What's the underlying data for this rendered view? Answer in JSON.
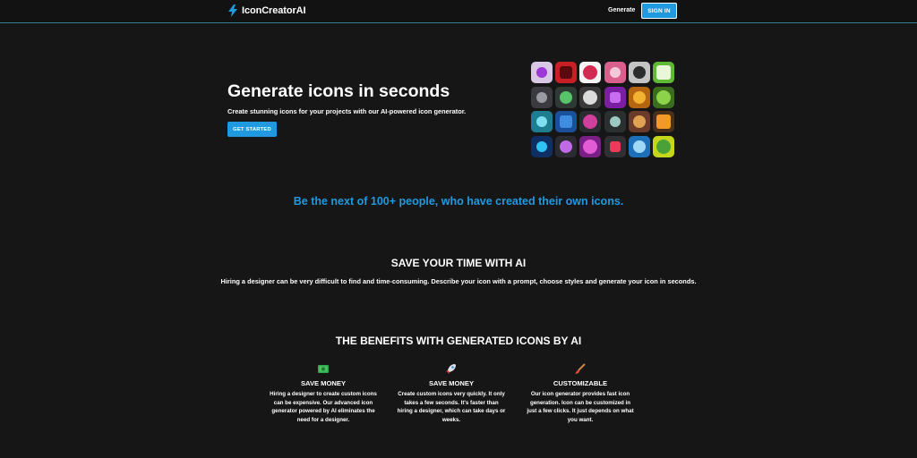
{
  "navbar": {
    "brand": "IconCreatorAI",
    "generate_link": "Generate",
    "signin_button": "SIGN IN"
  },
  "hero": {
    "title": "Generate icons in seconds",
    "subtitle": "Create stunning icons for your projects with our AI-powered icon generator.",
    "cta": "GET STARTED"
  },
  "gallery": {
    "tiles": [
      {
        "bg": "#d8c8e6",
        "fg": "#9b38d6"
      },
      {
        "bg": "#c81f25",
        "fg": "#5a0a0e"
      },
      {
        "bg": "#f4f4f4",
        "fg": "#d22a52"
      },
      {
        "bg": "#d95f8c",
        "fg": "#f4c9d8"
      },
      {
        "bg": "#c4c4c4",
        "fg": "#2c2c2c"
      },
      {
        "bg": "#5fb934",
        "fg": "#e9f6d8"
      },
      {
        "bg": "#3a3a40",
        "fg": "#9a9aa2"
      },
      {
        "bg": "#2f3a34",
        "fg": "#58c46a"
      },
      {
        "bg": "#3a3a3a",
        "fg": "#dcdcdc"
      },
      {
        "bg": "#7b1fa2",
        "fg": "#c86cf0"
      },
      {
        "bg": "#b5650f",
        "fg": "#f3b232"
      },
      {
        "bg": "#3b6e1c",
        "fg": "#8cd24a"
      },
      {
        "bg": "#1e7d90",
        "fg": "#7ee0ee"
      },
      {
        "bg": "#1a4f9a",
        "fg": "#3f8de0"
      },
      {
        "bg": "#2b2b32",
        "fg": "#d03f9b"
      },
      {
        "bg": "#2a3030",
        "fg": "#9ec9c3"
      },
      {
        "bg": "#6b3a2a",
        "fg": "#e0a152"
      },
      {
        "bg": "#4a3018",
        "fg": "#f19a2a"
      },
      {
        "bg": "#0f2f64",
        "fg": "#2fc4f6"
      },
      {
        "bg": "#2a2a30",
        "fg": "#c06ae6"
      },
      {
        "bg": "#7a1f86",
        "fg": "#e25cd6"
      },
      {
        "bg": "#2f2f34",
        "fg": "#ee3a5a"
      },
      {
        "bg": "#1c70b8",
        "fg": "#9fd8f5"
      },
      {
        "bg": "#c6d61c",
        "fg": "#4aa236"
      }
    ]
  },
  "tagline": "Be the next of 100+ people, who have created their own icons.",
  "save_time": {
    "title": "SAVE YOUR TIME WITH AI",
    "description": "Hiring a designer can be very difficult to find and time-consuming. Describe your icon with a prompt, choose styles and generate your icon in seconds."
  },
  "benefits": {
    "title": "THE BENEFITS WITH GENERATED ICONS BY AI",
    "items": [
      {
        "icon": "money-icon",
        "title": "SAVE MONEY",
        "text": "Hiring a designer to create custom icons can be expensive. Our advanced icon generator powered by AI eliminates the need for a designer."
      },
      {
        "icon": "rocket-icon",
        "title": "SAVE MONEY",
        "text": "Create custom icons very quickly. It only takes a few seconds. It's faster than hiring a designer, which can take days or weeks."
      },
      {
        "icon": "paintbrush-icon",
        "title": "CUSTOMIZABLE",
        "text": "Our icon generator provides fast icon generation. Icon can be customized in just a few clicks. It just depends on what you want."
      }
    ]
  },
  "colors": {
    "background": "#161616",
    "accent": "#1f9ae0",
    "text": "#ffffff"
  }
}
